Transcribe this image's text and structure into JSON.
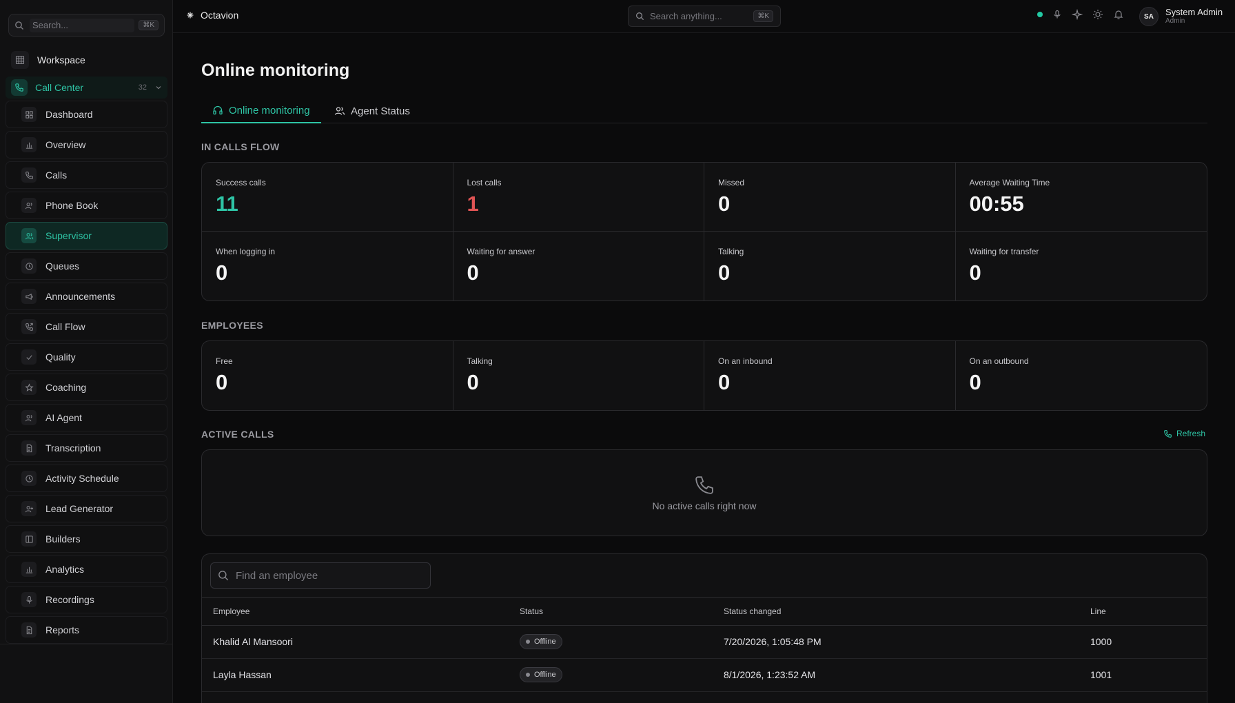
{
  "sidebar": {
    "search_placeholder": "Search...",
    "search_shortcut": "⌘K",
    "workspace_label": "Workspace",
    "call_center": {
      "label": "Call Center",
      "count": "32"
    },
    "items": [
      {
        "label": "Dashboard",
        "icon": "dashboard-icon"
      },
      {
        "label": "Overview",
        "icon": "bar-chart-icon"
      },
      {
        "label": "Calls",
        "icon": "phone-icon"
      },
      {
        "label": "Phone Book",
        "icon": "users-icon"
      },
      {
        "label": "Supervisor",
        "icon": "supervisor-icon",
        "active": true
      },
      {
        "label": "Queues",
        "icon": "clock-icon"
      },
      {
        "label": "Announcements",
        "icon": "megaphone-icon"
      },
      {
        "label": "Call Flow",
        "icon": "phone-forward-icon"
      },
      {
        "label": "Quality",
        "icon": "check-icon"
      },
      {
        "label": "Coaching",
        "icon": "star-icon"
      },
      {
        "label": "AI Agent",
        "icon": "users-icon"
      },
      {
        "label": "Transcription",
        "icon": "document-icon"
      },
      {
        "label": "Activity Schedule",
        "icon": "clock-icon"
      },
      {
        "label": "Lead Generator",
        "icon": "user-plus-icon"
      },
      {
        "label": "Builders",
        "icon": "layout-icon"
      },
      {
        "label": "Analytics",
        "icon": "bar-chart-icon"
      },
      {
        "label": "Recordings",
        "icon": "mic-icon"
      },
      {
        "label": "Reports",
        "icon": "document-icon"
      }
    ]
  },
  "topbar": {
    "brand": "Octavion",
    "search_placeholder": "Search anything...",
    "search_shortcut": "⌘K",
    "user": {
      "initials": "SA",
      "name": "System Admin",
      "role": "Admin"
    }
  },
  "page": {
    "title": "Online monitoring",
    "tabs": [
      {
        "label": "Online monitoring",
        "active": true
      },
      {
        "label": "Agent Status",
        "active": false
      }
    ]
  },
  "in_calls_flow": {
    "label": "IN CALLS FLOW",
    "metrics": [
      {
        "label": "Success calls",
        "value": "11",
        "tone": "green"
      },
      {
        "label": "Lost calls",
        "value": "1",
        "tone": "red"
      },
      {
        "label": "Missed",
        "value": "0"
      },
      {
        "label": "Average Waiting Time",
        "value": "00:55"
      },
      {
        "label": "When logging in",
        "value": "0"
      },
      {
        "label": "Waiting for answer",
        "value": "0"
      },
      {
        "label": "Talking",
        "value": "0"
      },
      {
        "label": "Waiting for transfer",
        "value": "0"
      }
    ]
  },
  "employees": {
    "label": "EMPLOYEES",
    "metrics": [
      {
        "label": "Free",
        "value": "0"
      },
      {
        "label": "Talking",
        "value": "0"
      },
      {
        "label": "On an inbound",
        "value": "0"
      },
      {
        "label": "On an outbound",
        "value": "0"
      }
    ]
  },
  "active_calls": {
    "label": "ACTIVE CALLS",
    "refresh_label": "Refresh",
    "empty_message": "No active calls right now"
  },
  "employee_table": {
    "search_placeholder": "Find an employee",
    "columns": [
      "Employee",
      "Status",
      "Status changed",
      "Line"
    ],
    "rows": [
      {
        "employee": "Khalid Al Mansoori",
        "status": "Offline",
        "status_changed": "7/20/2026, 1:05:48 PM",
        "line": "1000"
      },
      {
        "employee": "Layla Hassan",
        "status": "Offline",
        "status_changed": "8/1/2026, 1:23:52 AM",
        "line": "1001"
      }
    ]
  },
  "colors": {
    "accent": "#2ec4a5",
    "danger": "#e05454",
    "background": "#0b0b0c",
    "panel": "#111112"
  }
}
